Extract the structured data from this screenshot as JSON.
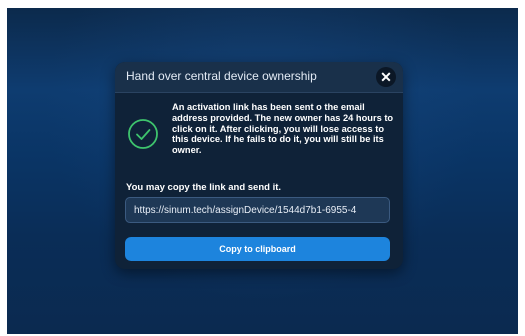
{
  "dialog": {
    "title": "Hand over central device ownership",
    "close_icon": "close-icon",
    "status_icon": "check-circle-icon",
    "colors": {
      "accent": "#1d84dd",
      "success": "#3ec46d",
      "background": "#0f2238"
    },
    "message": "An activation link has been sent o the email address provided. The new owner has 24 hours to click on it. After clicking, you will lose access to this device. If he fails to do it, you will still be its owner.",
    "copy_label": "You may copy the link and send it.",
    "link_value": "https://sinum.tech/assignDevice/1544d7b1-6955-4",
    "copy_button_label": "Copy to clipboard"
  }
}
